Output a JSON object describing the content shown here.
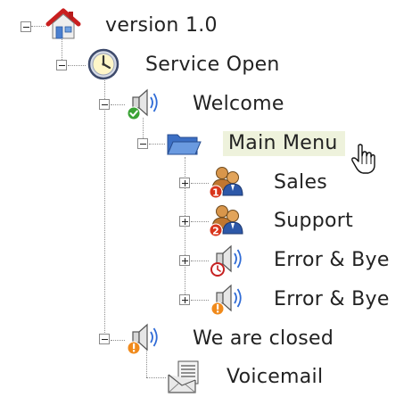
{
  "tree": {
    "root": {
      "label": "version 1.0",
      "icon": "home-icon"
    },
    "service_open": {
      "label": "Service Open",
      "icon": "clock-icon"
    },
    "welcome": {
      "label": "Welcome",
      "icon": "speaker-check-icon"
    },
    "main_menu": {
      "label": "Main Menu",
      "icon": "folder-open-icon"
    },
    "sales": {
      "label": "Sales",
      "icon": "users-badge-1-icon"
    },
    "support": {
      "label": "Support",
      "icon": "users-badge-2-icon"
    },
    "error_timeout": {
      "label": "Error & Bye",
      "icon": "speaker-clock-icon"
    },
    "error_invalid": {
      "label": "Error & Bye",
      "icon": "speaker-warning-icon"
    },
    "closed": {
      "label": "We are closed",
      "icon": "speaker-warning-icon"
    },
    "voicemail": {
      "label": "Voicemail",
      "icon": "voicemail-icon"
    }
  },
  "colors": {
    "selected_bg": "#eef2dc",
    "tree_line": "#8e8e8e",
    "badge_red": "#d9351b",
    "badge_orange": "#f08a1c",
    "badge_green": "#3aa335"
  }
}
